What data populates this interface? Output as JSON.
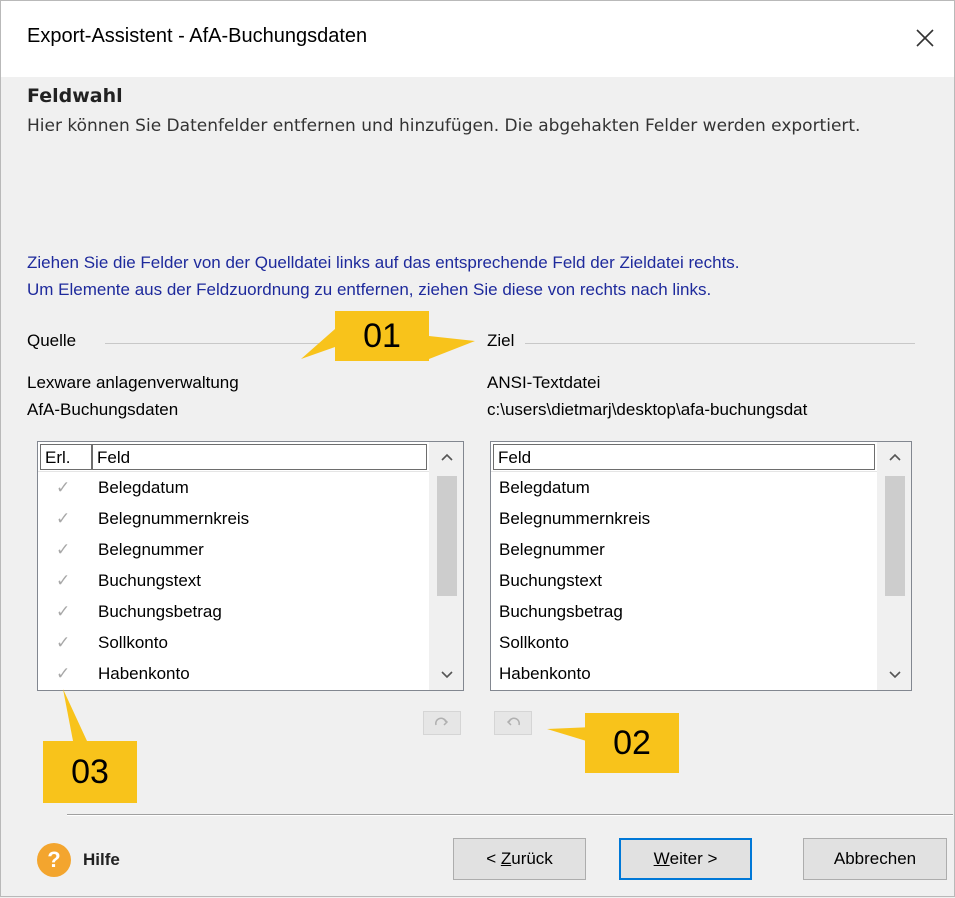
{
  "window": {
    "title": "Export-Assistent - AfA-Buchungsdaten",
    "close_icon": "close-icon"
  },
  "header": {
    "title": "Feldwahl",
    "description": "Hier können Sie Datenfelder entfernen und hinzufügen. Die abgehakten Felder werden exportiert."
  },
  "instruction": {
    "line1": "Ziehen Sie die Felder von der Quelldatei links auf das entsprechende Feld der Zieldatei rechts.",
    "line2": "Um Elemente aus der Feldzuordnung zu entfernen, ziehen Sie diese von rechts nach links."
  },
  "source": {
    "group_label": "Quelle",
    "line1": "Lexware anlagenverwaltung",
    "line2": "AfA-Buchungsdaten",
    "col_erl": "Erl.",
    "col_feld": "Feld",
    "items": [
      {
        "checked": true,
        "label": "Belegdatum"
      },
      {
        "checked": true,
        "label": "Belegnummernkreis"
      },
      {
        "checked": true,
        "label": "Belegnummer"
      },
      {
        "checked": true,
        "label": "Buchungstext"
      },
      {
        "checked": true,
        "label": "Buchungsbetrag"
      },
      {
        "checked": true,
        "label": "Sollkonto"
      },
      {
        "checked": true,
        "label": "Habenkonto"
      }
    ]
  },
  "target": {
    "group_label": "Ziel",
    "line1": "ANSI-Textdatei",
    "line2": "c:\\users\\dietmarj\\desktop\\afa-buchungsdat",
    "col_feld": "Feld",
    "items": [
      {
        "label": "Belegdatum"
      },
      {
        "label": "Belegnummernkreis"
      },
      {
        "label": "Belegnummer"
      },
      {
        "label": "Buchungstext"
      },
      {
        "label": "Buchungsbetrag"
      },
      {
        "label": "Sollkonto"
      },
      {
        "label": "Habenkonto"
      }
    ]
  },
  "annotations": {
    "a01": "01",
    "a02": "02",
    "a03": "03"
  },
  "footer": {
    "help_label": "Hilfe",
    "back_prefix": "< ",
    "back_underlined": "Z",
    "back_rest": "urück",
    "next_underlined": "W",
    "next_rest": "eiter >",
    "cancel_label": "Abbrechen"
  },
  "colors": {
    "instruction_text": "#1e2a9c",
    "annotation_bg": "#f8c31b",
    "help_icon": "#f3a52e",
    "default_button_border": "#0078d7"
  }
}
